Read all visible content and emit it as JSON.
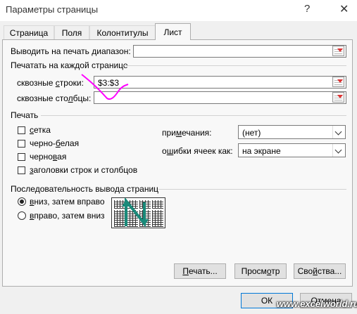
{
  "dialog": {
    "title": "Параметры страницы",
    "help": "?",
    "close": "✕"
  },
  "tabs": [
    {
      "label": "Страница"
    },
    {
      "label": "Поля"
    },
    {
      "label": "Колонтитулы"
    },
    {
      "label": "Лист"
    }
  ],
  "print_area": {
    "label_pre": "Выводить на печать ",
    "label_u": "д",
    "label_post": "иапазон:",
    "value": ""
  },
  "titles_section": "Печатать на каждой странице",
  "rows": {
    "label_pre": "сквозные ",
    "label_u": "с",
    "label_post": "троки:",
    "value": "$3:$3"
  },
  "cols": {
    "label_pre": "сквозные сто",
    "label_u": "л",
    "label_post": "бцы:",
    "value": ""
  },
  "print_section": "Печать",
  "checkboxes": [
    {
      "pre": "",
      "u": "с",
      "post": "етка"
    },
    {
      "pre": "черно-",
      "u": "б",
      "post": "елая"
    },
    {
      "pre": "черно",
      "u": "в",
      "post": "ая"
    },
    {
      "pre": "",
      "u": "з",
      "post": "аголовки строк и столбцов"
    }
  ],
  "comments": {
    "label_pre": "при",
    "label_u": "м",
    "label_post": "ечания:",
    "value": "(нет)"
  },
  "errors": {
    "label_pre": "о",
    "label_u": "ш",
    "label_post": "ибки ячеек как:",
    "value": "на экране"
  },
  "order_section": "Последовательность вывода страниц",
  "order": [
    {
      "pre": "",
      "u": "в",
      "post": "низ, затем вправо",
      "selected": true
    },
    {
      "pre": "",
      "u": "в",
      "post": "право, затем вниз",
      "selected": false
    }
  ],
  "buttons": {
    "print_pre": "",
    "print_u": "П",
    "print_post": "ечать...",
    "preview_pre": "Просм",
    "preview_u": "о",
    "preview_post": "тр",
    "options_pre": "Сво",
    "options_u": "й",
    "options_post": "ства...",
    "ok": "ОК",
    "cancel": "Отмена"
  },
  "watermark": "www.excelworld.ru",
  "colors": {
    "annotation": "#ff00ff",
    "arrow": "#1a8a7a"
  }
}
